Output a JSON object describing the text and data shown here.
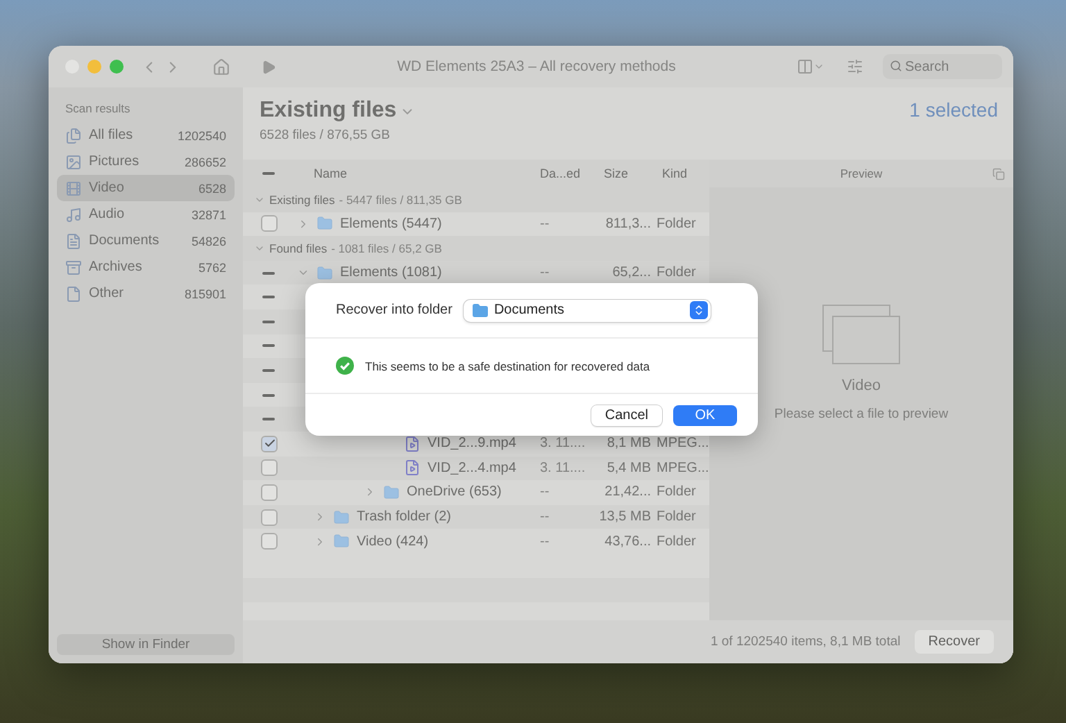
{
  "window": {
    "title": "WD Elements 25A3 – All recovery methods",
    "search": {
      "placeholder": "Search"
    }
  },
  "sidebar": {
    "heading": "Scan results",
    "items": [
      {
        "kind": "all",
        "label": "All files",
        "count": "1202540",
        "selected": false
      },
      {
        "kind": "pictures",
        "label": "Pictures",
        "count": "286652",
        "selected": false
      },
      {
        "kind": "video",
        "label": "Video",
        "count": "6528",
        "selected": true
      },
      {
        "kind": "audio",
        "label": "Audio",
        "count": "32871",
        "selected": false
      },
      {
        "kind": "documents",
        "label": "Documents",
        "count": "54826",
        "selected": false
      },
      {
        "kind": "archives",
        "label": "Archives",
        "count": "5762",
        "selected": false
      },
      {
        "kind": "other",
        "label": "Other",
        "count": "815901",
        "selected": false
      }
    ],
    "button": "Show in Finder"
  },
  "header": {
    "title": "Existing files",
    "subtitle": "6528 files / 876,55 GB",
    "selection": "1 selected"
  },
  "table": {
    "header": {
      "mixed": true
    },
    "columns": [
      "Name",
      "Da...ed",
      "Size",
      "Kind"
    ],
    "groups": [
      {
        "title": "Existing files",
        "summary": "- 5447 files / 811,35 GB",
        "rows": [
          {
            "kind": "folder",
            "name": "Elements (5447)",
            "checked": false,
            "mixed": false,
            "expanded": false,
            "date": "--",
            "size": "811,3...",
            "type": "Folder"
          }
        ]
      },
      {
        "title": "Found files",
        "summary": "- 1081 files / 65,2 GB",
        "rows": [
          {
            "kind": "folder",
            "name": "Elements (1081)",
            "mixed": true,
            "expanded": true,
            "date": "--",
            "size": "65,2...",
            "type": "Folder",
            "children": [
              {
                "mixed": true,
                "children": [
                  {
                    "mixed": true,
                    "children": [
                      {
                        "mixed": true,
                        "children": [
                          {
                            "mixed": true
                          },
                          {
                            "mixed": true
                          },
                          {
                            "mixed": true,
                            "children": [
                              {
                                "kind": "file",
                                "name": "VID_2...9.mp4",
                                "checked": true,
                                "mixed": false,
                                "date": "3. 11....",
                                "size": "8,1 MB",
                                "type": "MPEG..."
                              },
                              {
                                "kind": "file",
                                "name": "VID_2...4.mp4",
                                "checked": false,
                                "mixed": false,
                                "date": "3. 11....",
                                "size": "5,4 MB",
                                "type": "MPEG..."
                              }
                            ]
                          },
                          {
                            "kind": "folder",
                            "name": "OneDrive (653)",
                            "checked": false,
                            "mixed": false,
                            "expanded": false,
                            "date": "--",
                            "size": "21,42...",
                            "type": "Folder"
                          }
                        ]
                      }
                    ]
                  }
                ]
              },
              {
                "kind": "folder",
                "name": "Trash folder (2)",
                "checked": false,
                "mixed": false,
                "expanded": false,
                "date": "--",
                "size": "13,5 MB",
                "type": "Folder"
              },
              {
                "kind": "folder",
                "name": "Video (424)",
                "checked": false,
                "mixed": false,
                "expanded": false,
                "date": "--",
                "size": "43,76...",
                "type": "Folder"
              }
            ]
          }
        ]
      }
    ]
  },
  "preview": {
    "heading": "Preview",
    "title": "Video",
    "hint": "Please select a file to preview"
  },
  "footer": {
    "status": "1 of 1202540 items, 8,1 MB total",
    "button": "Recover"
  },
  "dialog": {
    "label": "Recover into folder",
    "folder": "Documents",
    "message": "This seems to be a safe destination for recovered data",
    "buttons": [
      {
        "label": "Cancel",
        "primary": false
      },
      {
        "label": "OK",
        "primary": true
      }
    ]
  }
}
